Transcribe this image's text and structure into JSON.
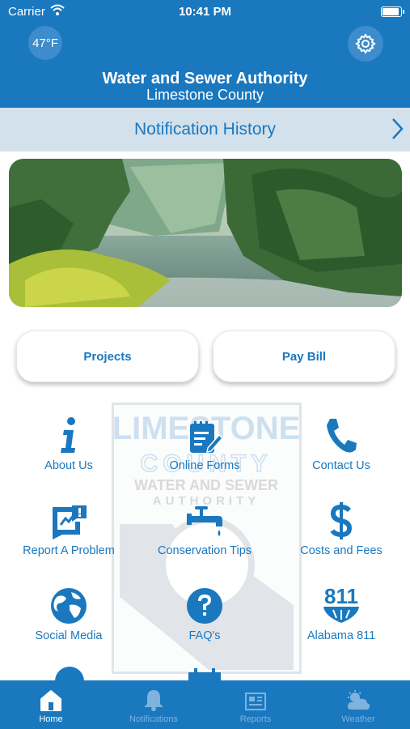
{
  "status_bar": {
    "carrier": "Carrier",
    "time": "10:41 PM"
  },
  "header": {
    "temperature": "47°F",
    "title": "Water and Sewer Authority",
    "subtitle": "Limestone County",
    "settings_icon": "gear-icon"
  },
  "notification_bar": {
    "label": "Notification History",
    "icon": "chevron-right-icon"
  },
  "buttons": {
    "projects": "Projects",
    "pay_bill": "Pay Bill"
  },
  "watermark": {
    "line1": "LIMESTONE",
    "line2": "COUNTY",
    "line3": "WATER AND SEWER",
    "line4": "AUTHORITY"
  },
  "grid": [
    {
      "label": "About Us",
      "icon": "info-icon"
    },
    {
      "label": "Online Forms",
      "icon": "form-icon"
    },
    {
      "label": "Contact Us",
      "icon": "phone-icon"
    },
    {
      "label": "Report A Problem",
      "icon": "report-icon"
    },
    {
      "label": "Conservation Tips",
      "icon": "faucet-icon"
    },
    {
      "label": "Costs and Fees",
      "icon": "dollar-icon"
    },
    {
      "label": "Social Media",
      "icon": "globe-icon"
    },
    {
      "label": "FAQ's",
      "icon": "question-icon"
    },
    {
      "label": "Alabama 811",
      "icon": "811-logo-icon",
      "logo_text": "811"
    }
  ],
  "tabs": [
    {
      "label": "Home",
      "icon": "home-icon",
      "active": true
    },
    {
      "label": "Notifications",
      "icon": "bell-icon",
      "active": false
    },
    {
      "label": "Reports",
      "icon": "reports-icon",
      "active": false
    },
    {
      "label": "Weather",
      "icon": "weather-icon",
      "active": false
    }
  ],
  "colors": {
    "primary": "#1a78bf",
    "banner": "#d3e1ec",
    "tab_inactive": "#7fb2dc"
  }
}
